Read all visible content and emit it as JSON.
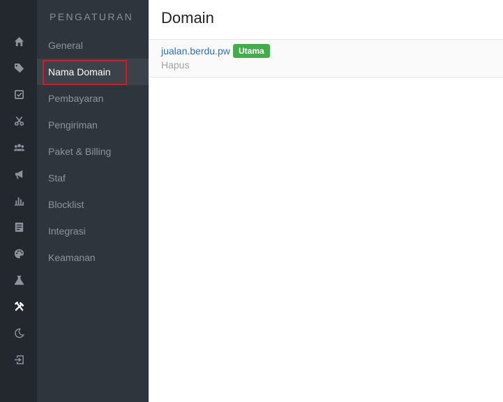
{
  "rail": {
    "icons": [
      "home-icon",
      "tag-icon",
      "checkbox-icon",
      "scissors-icon",
      "users-icon",
      "megaphone-icon",
      "bar-chart-icon",
      "document-icon",
      "palette-icon",
      "flask-icon",
      "tools-icon",
      "moon-icon",
      "logout-icon"
    ],
    "active_icon": "tools-icon"
  },
  "subnav": {
    "heading": "PENGATURAN",
    "items": [
      {
        "label": "General"
      },
      {
        "label": "Nama Domain",
        "active": true
      },
      {
        "label": "Pembayaran"
      },
      {
        "label": "Pengiriman"
      },
      {
        "label": "Paket & Billing"
      },
      {
        "label": "Staf"
      },
      {
        "label": "Blocklist"
      },
      {
        "label": "Integrasi"
      },
      {
        "label": "Keamanan"
      }
    ]
  },
  "main": {
    "title": "Domain",
    "domains": [
      {
        "name": "jualan.berdu.pw",
        "badge": "Utama",
        "action": "Hapus"
      }
    ]
  },
  "colors": {
    "rail_bg": "#23272e",
    "subnav_bg": "#2f353d",
    "active_item_bg": "#3c424a",
    "highlight_border": "#e3141e",
    "link": "#2f6fbf",
    "badge_green": "#44ad4b"
  }
}
